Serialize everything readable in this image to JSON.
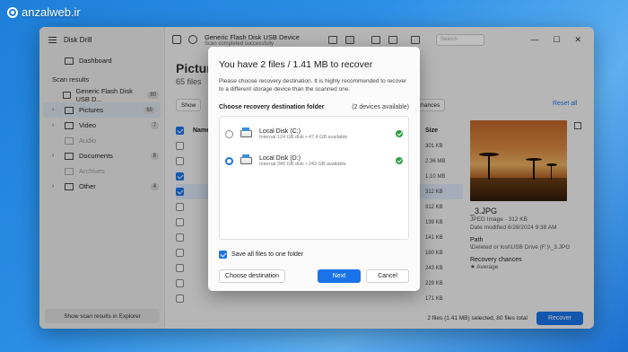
{
  "watermark": {
    "text": "anzalweb.ir"
  },
  "app": {
    "title": "Disk Drill"
  },
  "sidebar": {
    "dashboard": "Dashboard",
    "scan_results_title": "Scan results",
    "device": {
      "label": "Generic Flash Disk USB D...",
      "count": "80"
    },
    "items": [
      {
        "label": "Pictures",
        "count": "65",
        "active": true,
        "muted": false
      },
      {
        "label": "Video",
        "count": "7",
        "active": false,
        "muted": false
      },
      {
        "label": "Audio",
        "count": "",
        "active": false,
        "muted": true
      },
      {
        "label": "Documents",
        "count": "8",
        "active": false,
        "muted": false
      },
      {
        "label": "Archives",
        "count": "",
        "active": false,
        "muted": true
      },
      {
        "label": "Other",
        "count": "4",
        "active": false,
        "muted": false
      }
    ],
    "footer_button": "Show scan results in Explorer"
  },
  "header": {
    "device_title": "Generic Flash Disk USB Device",
    "device_status": "Scan completed successfully",
    "search_placeholder": "Search",
    "minimize": "—",
    "maximize": "☐",
    "close": "✕"
  },
  "main": {
    "title": "Pictures",
    "subtitle": "65 files",
    "show_label": "Show",
    "chances_label": "chances",
    "reset_all": "Reset all",
    "col_name": "Name",
    "col_size": "Size",
    "rows": [
      {
        "checked": false,
        "size": "301 KB",
        "selected": false
      },
      {
        "checked": false,
        "size": "2.36 MB",
        "selected": false
      },
      {
        "checked": true,
        "size": "1.10 MB",
        "selected": false
      },
      {
        "checked": true,
        "size": "312 KB",
        "selected": true
      },
      {
        "checked": false,
        "size": "312 KB",
        "selected": false
      },
      {
        "checked": false,
        "size": "139 KB",
        "selected": false
      },
      {
        "checked": false,
        "size": "141 KB",
        "selected": false
      },
      {
        "checked": false,
        "size": "160 KB",
        "selected": false
      },
      {
        "checked": false,
        "size": "243 KB",
        "selected": false
      },
      {
        "checked": false,
        "size": "229 KB",
        "selected": false
      },
      {
        "checked": false,
        "size": "171 KB",
        "selected": false
      }
    ]
  },
  "preview": {
    "filename": "_3.JPG",
    "type": "JPEG Image - 312 KB",
    "modified": "Date modified 6/28/2024 9:38 AM",
    "path_label": "Path",
    "path_value": "\\Deleted or lost\\USB Drive (F:)\\_3.JPG",
    "chances_label": "Recovery chances",
    "chances_value": "Average"
  },
  "status": {
    "text": "2 files (1.41 MB) selected, 80 files total",
    "recover_button": "Recover"
  },
  "dialog": {
    "title": "You have 2 files / 1.41 MB to recover",
    "description": "Please choose recovery destination. It is highly recommended to recover to a different storage device than the scanned one.",
    "folder_label": "Choose recovery destination folder",
    "devices_available": "(2 devices available)",
    "destinations": [
      {
        "name": "Local Disk (C:)",
        "info": "Internal 124 GB disk • 47.4 GB available",
        "selected": false
      },
      {
        "name": "Local Disk (D:)",
        "info": "Internal 340 GB disk • 243 GB available",
        "selected": true
      }
    ],
    "save_all_label": "Save all files to one folder",
    "choose_button": "Choose destination",
    "next_button": "Next",
    "cancel_button": "Cancel"
  },
  "colors": {
    "accent": "#1a73e8",
    "success": "#2ea043"
  }
}
